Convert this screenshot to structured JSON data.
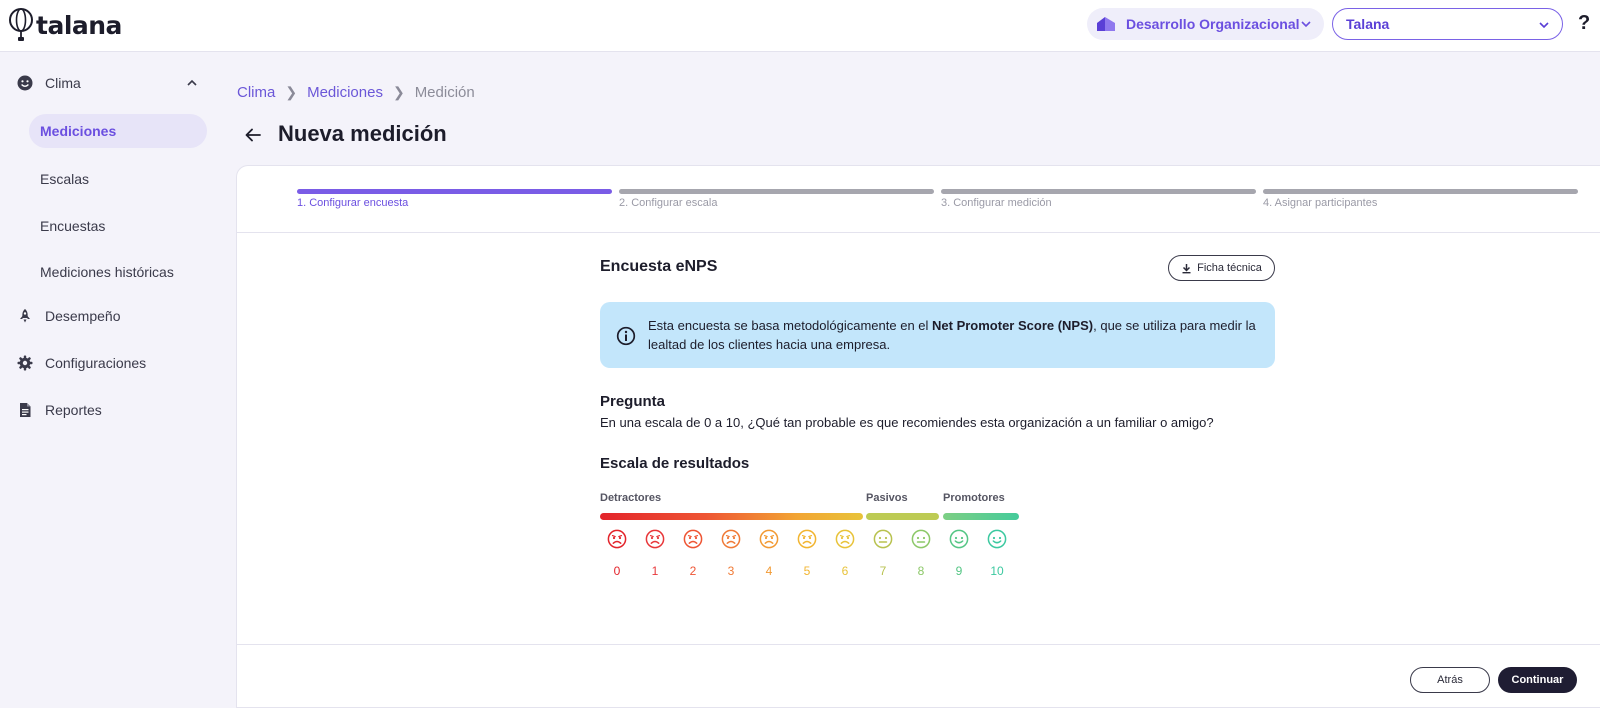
{
  "header": {
    "logo_text": "talana",
    "module_label": "Desarrollo Organizacional",
    "company_label": "Talana",
    "help_label": "?"
  },
  "sidebar": {
    "clima": "Clima",
    "sub_items": [
      "Mediciones",
      "Escalas",
      "Encuestas",
      "Mediciones históricas"
    ],
    "desempeno": "Desempeño",
    "configuraciones": "Configuraciones",
    "reportes": "Reportes"
  },
  "breadcrumb": {
    "items": [
      "Clima",
      "Mediciones"
    ],
    "current": "Medición"
  },
  "page": {
    "title": "Nueva medición"
  },
  "steps": [
    "1. Configurar encuesta",
    "2. Configurar escala",
    "3. Configurar medición",
    "4. Asignar participantes"
  ],
  "survey": {
    "title": "Encuesta eNPS",
    "ficha_label": "Ficha técnica",
    "info_pre": "Esta encuesta se basa metodológicamente en el ",
    "info_bold": "Net Promoter Score (NPS)",
    "info_post": ", que se utiliza para medir la lealtad de los clientes hacia una empresa.",
    "question_title": "Pregunta",
    "question_text": "En una escala de 0 a 10, ¿Qué tan probable es que recomiendes esta organización a un familiar o amigo?",
    "scale_title": "Escala de resultados"
  },
  "scale": {
    "groups": [
      "Detractores",
      "Pasivos",
      "Promotores"
    ],
    "values": [
      "0",
      "1",
      "2",
      "3",
      "4",
      "5",
      "6",
      "7",
      "8",
      "9",
      "10"
    ],
    "colors": [
      "#e3242b",
      "#e8373a",
      "#ee5534",
      "#f07a36",
      "#f29a34",
      "#f2b531",
      "#e8c33a",
      "#b8c24f",
      "#8cc868",
      "#55c685",
      "#3cc9a0"
    ]
  },
  "footer": {
    "back_label": "Atrás",
    "continue_label": "Continuar"
  }
}
